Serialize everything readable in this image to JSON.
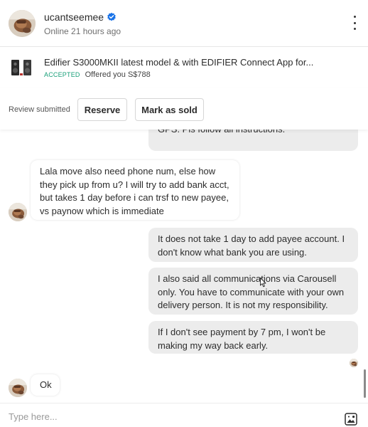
{
  "header": {
    "username": "ucantseemee",
    "status": "Online 21 hours ago",
    "verified_icon": "verified-badge-icon",
    "menu_icon": "more-vertical-icon"
  },
  "listing": {
    "title": "Edifier S3000MKII latest model & with EDIFIER Connect App for...",
    "status_badge": "ACCEPTED",
    "offer_text": "Offered you S$788",
    "thumbnail_icon": "speaker-thumbnail"
  },
  "actions": {
    "review_text": "Review submitted",
    "reserve_label": "Reserve",
    "mark_sold_label": "Mark as sold"
  },
  "messages": [
    {
      "direction": "outgoing",
      "text": "stated. Everybody can find it using the info on GPS. Pls follow all instructions."
    },
    {
      "direction": "incoming",
      "text": "Lala move also need phone num, else how they pick up from u? I will try to add bank acct, but takes 1 day before i can trsf to new payee, vs paynow which is immediate"
    },
    {
      "direction": "outgoing",
      "text": "It does not take 1 day to add payee account. I don't know what bank you are using."
    },
    {
      "direction": "outgoing",
      "text": "I also said all communications via Carousell only. You have to communicate with your own delivery person. It is not my responsibility."
    },
    {
      "direction": "outgoing",
      "text": "If I don't see payment by 7 pm, I won't be making my way back early."
    },
    {
      "direction": "incoming",
      "text": "Ok"
    }
  ],
  "composer": {
    "placeholder": "Type here...",
    "photo_icon": "add-photo-icon"
  },
  "colors": {
    "accepted": "#1aa07a",
    "verified": "#1a73e8",
    "outgoing_bubble": "#ececec"
  }
}
